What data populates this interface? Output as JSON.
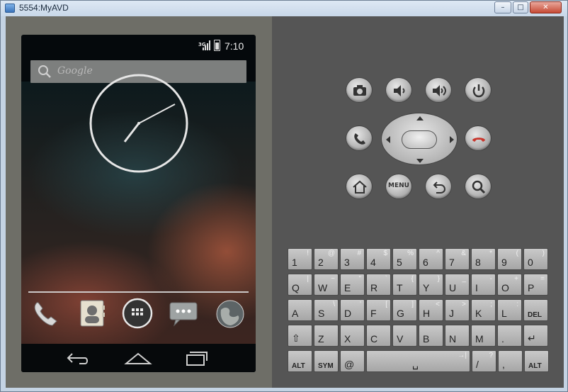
{
  "window": {
    "title": "5554:MyAVD",
    "min_label": "–",
    "max_label": "□",
    "close_label": "✕"
  },
  "status": {
    "network": "3G",
    "time": "7:10"
  },
  "search": {
    "placeholder": "Google"
  },
  "dock": {
    "apps": [
      "phone-app-icon",
      "contacts-app-icon",
      "all-apps-icon",
      "messaging-app-icon",
      "browser-app-icon"
    ]
  },
  "navbar": {
    "buttons": [
      "back-icon",
      "home-icon",
      "recent-apps-icon"
    ]
  },
  "controls": {
    "row1": [
      "camera-icon",
      "volume-down-icon",
      "volume-up-icon",
      "power-icon"
    ],
    "row3": [
      "home-icon",
      "menu-button",
      "back-icon",
      "search-icon"
    ],
    "menu_label": "MENU"
  },
  "keyboard": {
    "row1": [
      {
        "main": "1",
        "alt": "!"
      },
      {
        "main": "2",
        "alt": "@"
      },
      {
        "main": "3",
        "alt": "#"
      },
      {
        "main": "4",
        "alt": "$"
      },
      {
        "main": "5",
        "alt": "%"
      },
      {
        "main": "6",
        "alt": "^"
      },
      {
        "main": "7",
        "alt": "&"
      },
      {
        "main": "8",
        "alt": "*"
      },
      {
        "main": "9",
        "alt": "("
      },
      {
        "main": "0",
        "alt": ")"
      }
    ],
    "row2": [
      {
        "main": "Q",
        "alt": "|"
      },
      {
        "main": "W",
        "alt": "~"
      },
      {
        "main": "E",
        "alt": "\""
      },
      {
        "main": "R",
        "alt": "`"
      },
      {
        "main": "T",
        "alt": "{"
      },
      {
        "main": "Y",
        "alt": "}"
      },
      {
        "main": "U",
        "alt": "_"
      },
      {
        "main": "I",
        "alt": "-"
      },
      {
        "main": "O",
        "alt": "+"
      },
      {
        "main": "P",
        "alt": "="
      }
    ],
    "row3": [
      {
        "main": "A",
        "alt": ""
      },
      {
        "main": "S",
        "alt": "\\"
      },
      {
        "main": "D",
        "alt": "'"
      },
      {
        "main": "F",
        "alt": "["
      },
      {
        "main": "G",
        "alt": "]"
      },
      {
        "main": "H",
        "alt": "<"
      },
      {
        "main": "J",
        "alt": ">"
      },
      {
        "main": "K",
        "alt": ";"
      },
      {
        "main": "L",
        "alt": ":"
      },
      {
        "main": "DEL",
        "alt": ""
      }
    ],
    "row4": [
      {
        "main": "⇧",
        "alt": ""
      },
      {
        "main": "Z",
        "alt": ""
      },
      {
        "main": "X",
        "alt": ""
      },
      {
        "main": "C",
        "alt": ""
      },
      {
        "main": "V",
        "alt": ""
      },
      {
        "main": "B",
        "alt": ""
      },
      {
        "main": "N",
        "alt": ""
      },
      {
        "main": "M",
        "alt": ""
      },
      {
        "main": ".",
        "alt": ""
      },
      {
        "main": "↵",
        "alt": ""
      }
    ],
    "row5": {
      "alt_left": "ALT",
      "sym": "SYM",
      "at": "@",
      "space": "␣",
      "tab": "→|",
      "slash": "/",
      "slash_alt": "?",
      "comma": ",",
      "alt_right": "ALT"
    }
  }
}
